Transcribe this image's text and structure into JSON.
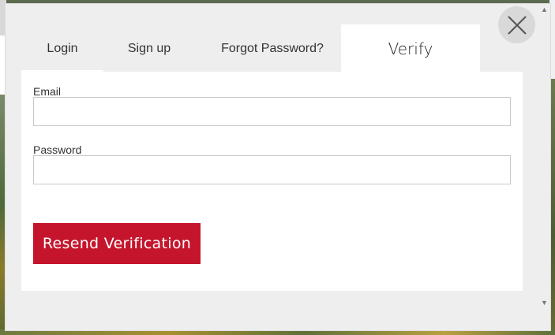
{
  "tabs": [
    {
      "label": "Login"
    },
    {
      "label": "Sign up"
    },
    {
      "label": "Forgot Password?"
    },
    {
      "label": "Verify",
      "active": true
    }
  ],
  "form": {
    "email_label": "Email",
    "email_value": "",
    "password_label": "Password",
    "password_value": "",
    "submit_label": "Resend Verification"
  },
  "colors": {
    "accent": "#c4152c",
    "modal_bg": "#eeeeee",
    "panel_bg": "#ffffff"
  },
  "icons": {
    "close": "close-icon",
    "scroll_up": "scroll-up-arrow-icon",
    "scroll_down": "scroll-down-arrow-icon"
  }
}
